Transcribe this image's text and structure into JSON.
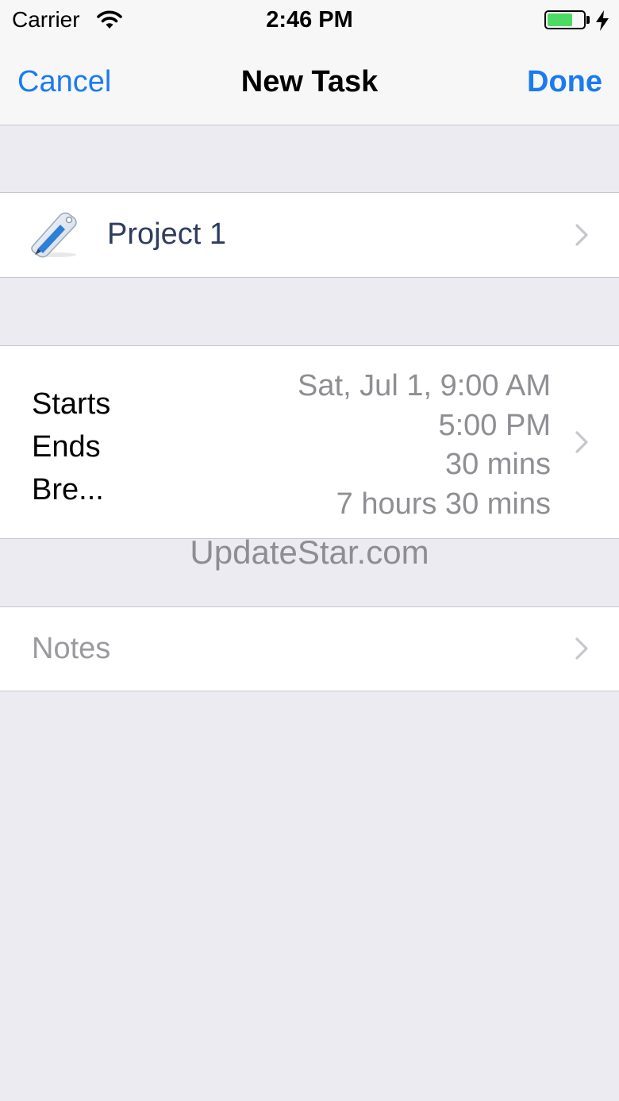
{
  "status_bar": {
    "carrier": "Carrier",
    "time": "2:46 PM",
    "battery_level": 0.7,
    "battery_color": "#4cd964"
  },
  "nav": {
    "cancel_label": "Cancel",
    "title": "New Task",
    "done_label": "Done",
    "accent": "#1a7bf0"
  },
  "project": {
    "label": "Project 1",
    "icon": "pencil-tag-icon"
  },
  "schedule": {
    "labels": [
      "Starts",
      "Ends",
      "Bre..."
    ],
    "values": [
      "Sat, Jul 1, 9:00 AM",
      "5:00 PM",
      "30 mins",
      "7 hours 30 mins"
    ]
  },
  "watermark": "UpdateStar.com",
  "notes": {
    "placeholder": "Notes"
  }
}
